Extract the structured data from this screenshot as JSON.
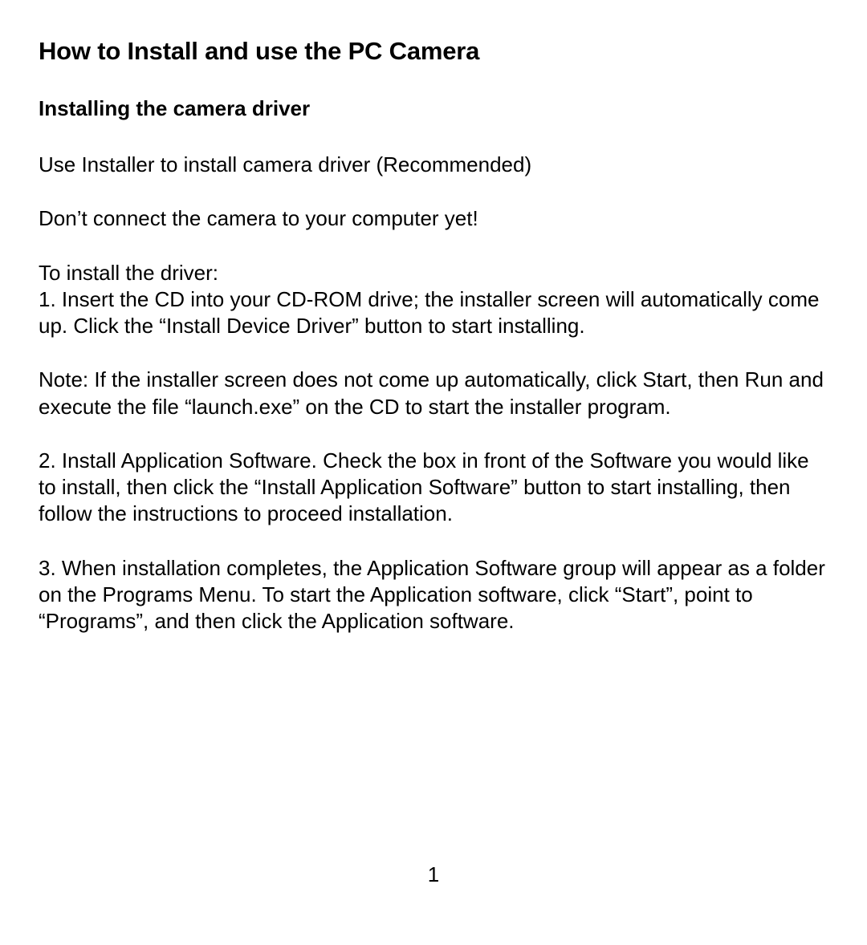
{
  "title": "How to Install and use the PC Camera",
  "subhead": "Installing the camera driver",
  "p1": "Use Installer to install camera driver (Recommended)",
  "p2": "Don’t connect the camera to your computer yet!",
  "install_lead": "To install the driver:",
  "step1": "1. Insert the CD into your CD-ROM drive; the installer screen will automatically come up. Click the “Install Device Driver” button to start installing.",
  "note": "Note: If the installer screen does not come up automatically, click Start, then Run and execute the file “launch.exe” on the CD to start the installer program.",
  "step2": "2.  Install Application Software. Check the box in front of the Software you would like to install, then click the “Install Application Software” button to start installing, then follow the instructions to proceed installation.",
  "step3": "3. When installation completes, the Application Software group will appear as a folder on the Programs Menu. To start the Application software, click “Start”, point to “Programs”, and then click the Application software.",
  "page_number": "1"
}
